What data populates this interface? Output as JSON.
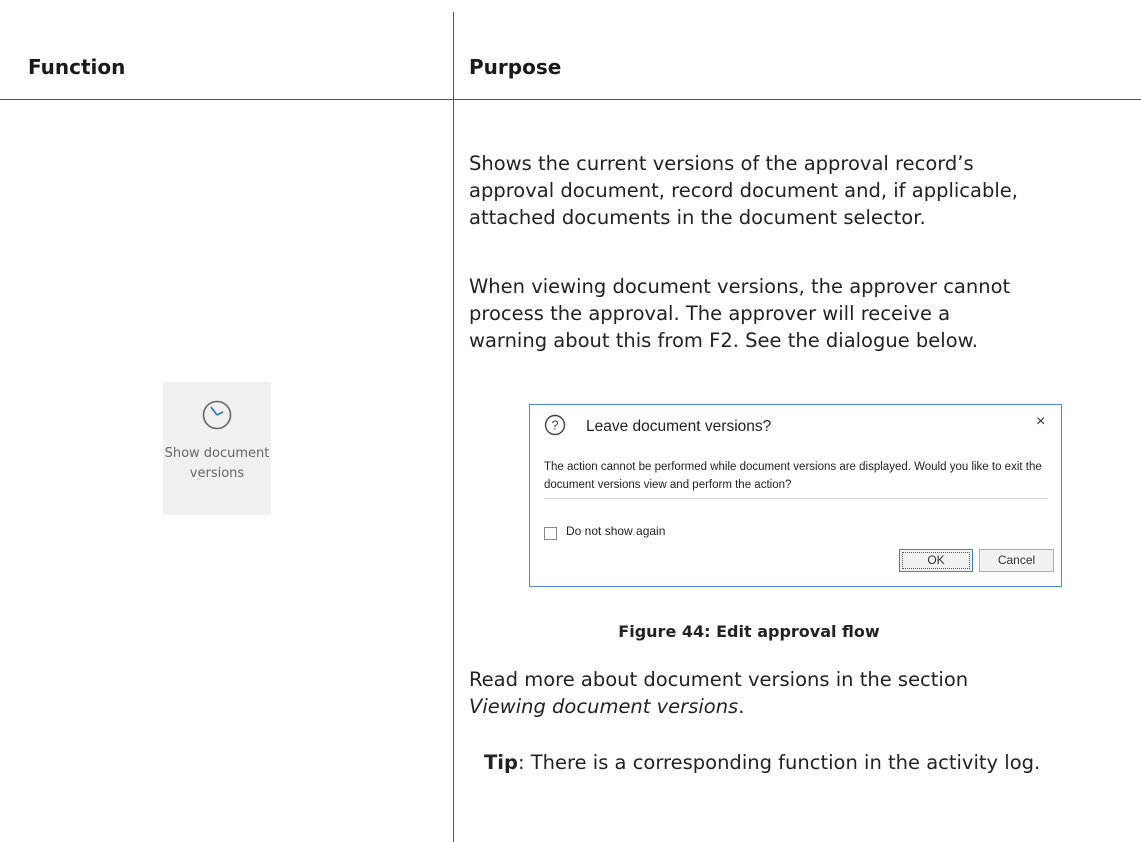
{
  "table": {
    "headers": [
      "Function",
      "Purpose"
    ]
  },
  "function_button": {
    "icon": "clock-icon",
    "label": "Show document versions"
  },
  "purpose": {
    "paragraph1": "Shows the current versions of the approval record’s approval document, record document and, if applicable, attached documents in the document selector.",
    "paragraph2": "When viewing document versions, the approver cannot process the approval. The approver will receive a warning about this from F2. See the dialogue below.",
    "paragraph3_prefix": "Read more about document versions in the section ",
    "paragraph3_link": "Viewing document versions",
    "paragraph3_suffix": ".",
    "tip_label": "Tip",
    "tip_text": ": There is a corresponding function in the activity log."
  },
  "dialog": {
    "icon": "question-circle-icon",
    "title": "Leave document versions?",
    "close_symbol": "×",
    "message": "The action cannot be performed while document versions are displayed. Would you like to exit the document versions view and perform the action?",
    "checkbox_label": "Do not show again",
    "ok_label": "OK",
    "cancel_label": "Cancel"
  },
  "figure_caption": "Figure 44: Edit approval flow",
  "colors": {
    "dialog_border": "#4a8fd6",
    "rule": "#555555"
  }
}
